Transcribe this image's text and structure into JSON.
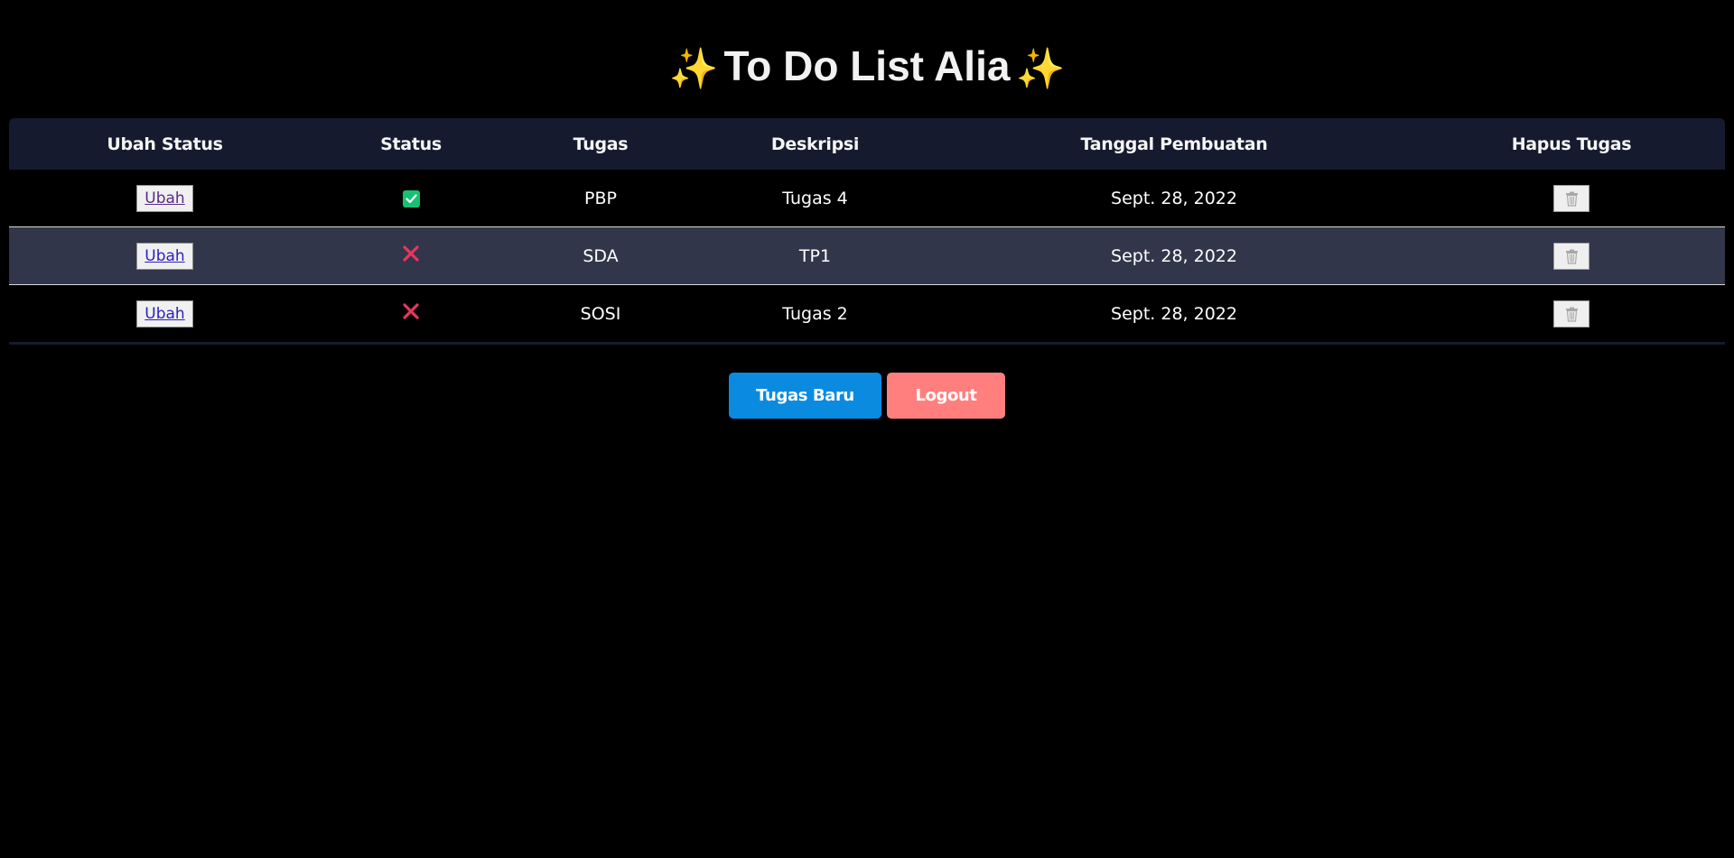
{
  "header": {
    "title": "To Do List Alia",
    "sparkle_left": "✨",
    "sparkle_right": "✨"
  },
  "table": {
    "columns": [
      "Ubah Status",
      "Status",
      "Tugas",
      "Deskripsi",
      "Tanggal Pembuatan",
      "Hapus Tugas"
    ],
    "rows": [
      {
        "change_label": "Ubah",
        "status": "done",
        "task": "PBP",
        "description": "Tugas 4",
        "date": "Sept. 28, 2022"
      },
      {
        "change_label": "Ubah",
        "status": "not-done",
        "task": "SDA",
        "description": "TP1",
        "date": "Sept. 28, 2022"
      },
      {
        "change_label": "Ubah",
        "status": "not-done",
        "task": "SOSI",
        "description": "Tugas 2",
        "date": "Sept. 28, 2022"
      }
    ]
  },
  "actions": {
    "new_task_label": "Tugas Baru",
    "logout_label": "Logout"
  },
  "colors": {
    "background": "#000000",
    "header_row": "#151a2e",
    "alt_row": "#32364a",
    "status_done": "#16c172",
    "status_not_done": "#e8365d",
    "new_task_button": "#0b8be0",
    "logout_button": "#ff7f7f"
  },
  "icons": {
    "status_done": "check-square-icon",
    "status_not_done": "cross-icon",
    "delete": "trash-icon",
    "title_decoration": "sparkles-icon"
  }
}
